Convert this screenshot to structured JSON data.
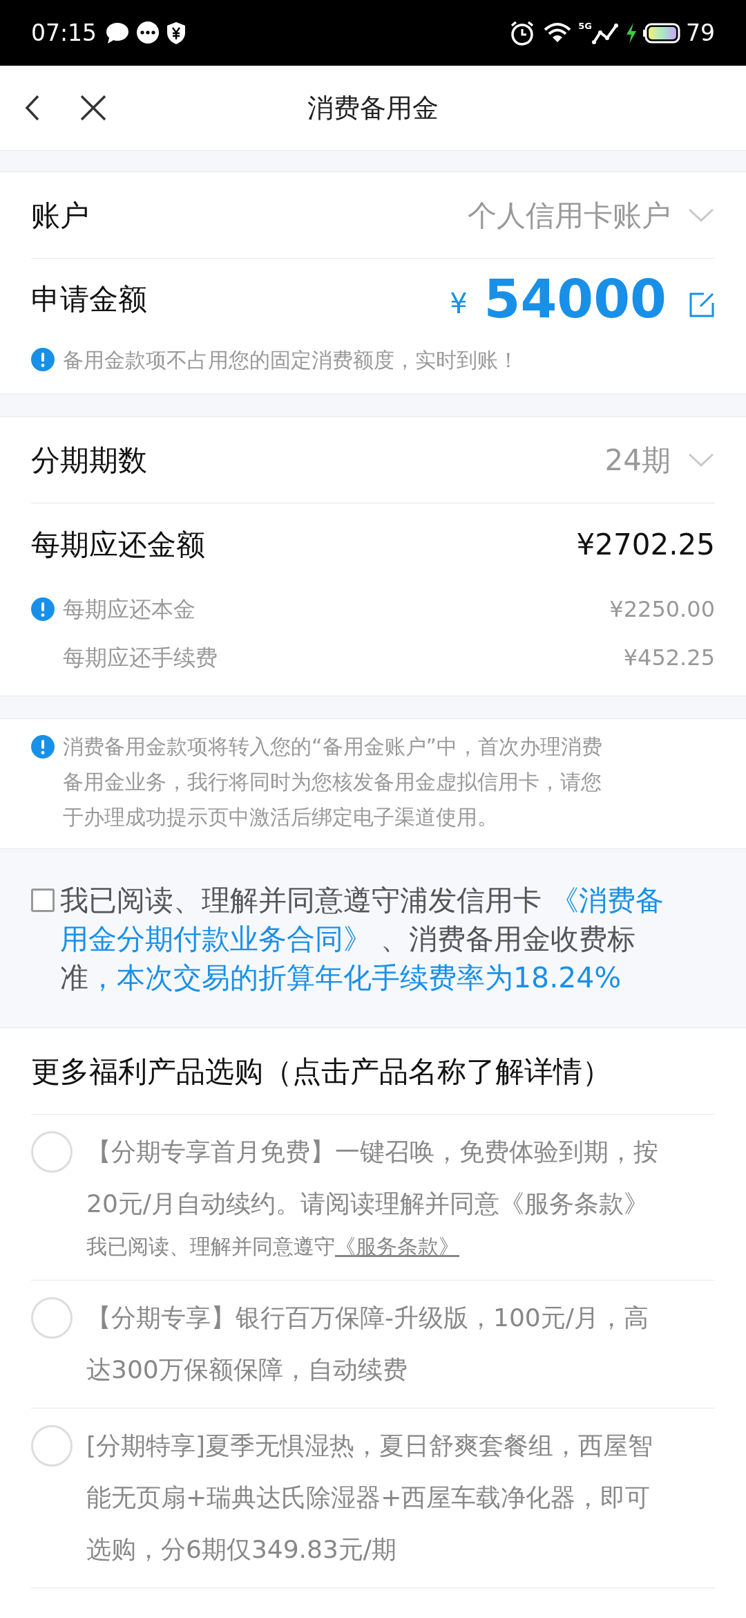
{
  "status_bar": {
    "time": "07:15",
    "network": "5G",
    "battery": "79"
  },
  "nav": {
    "title": "消费备用金"
  },
  "account": {
    "label": "账户",
    "value": "个人信用卡账户"
  },
  "amount": {
    "label": "申请金额",
    "currency": "¥",
    "value": "54000",
    "note": "备用金款项不占用您的固定消费额度，实时到账！"
  },
  "installments": {
    "label": "分期期数",
    "value": "24期"
  },
  "repayment": {
    "label": "每期应还金额",
    "value": "¥2702.25",
    "details": [
      {
        "label": "每期应还本金",
        "value": "¥2250.00",
        "info": true
      },
      {
        "label": "每期应还手续费",
        "value": "¥452.25",
        "info": false
      }
    ]
  },
  "notice": "消费备用金款项将转入您的“备用金账户”中，首次办理消费备用金业务，我行将同时为您核发备用金虚拟信用卡，请您于办理成功提示页中激活后绑定电子渠道使用。",
  "agreement": {
    "checked": false,
    "parts": [
      {
        "text": "我已阅读、理解并同意遵守浦发信用卡 ",
        "kind": "plain"
      },
      {
        "text": "《消费备用金分期付款业务合同》",
        "kind": "link"
      },
      {
        "text": " 、消费备用金收费标准",
        "kind": "plain"
      },
      {
        "text": "，本次交易的折算年化手续费率为18.24%",
        "kind": "link"
      }
    ]
  },
  "products": {
    "title": "更多福利产品选购（点击产品名称了解详情）",
    "items": [
      {
        "text": "【分期专享首月免费】一键召唤，免费体验到期，按20元/月自动续约。请阅读理解并同意《服务条款》",
        "selected": false,
        "consent": {
          "text": "我已阅读、理解并同意遵守",
          "link": "《服务条款》"
        }
      },
      {
        "text": "【分期专享】银行百万保障-升级版，100元/月，高达300万保额保障，自动续费",
        "selected": false
      },
      {
        "text": "[分期特享]夏季无惧湿热，夏日舒爽套餐组，西屋智能无页扇+瑞典达氏除湿器+西屋车载净化器，即可选购，分6期仅349.83元/期",
        "selected": false
      }
    ]
  }
}
